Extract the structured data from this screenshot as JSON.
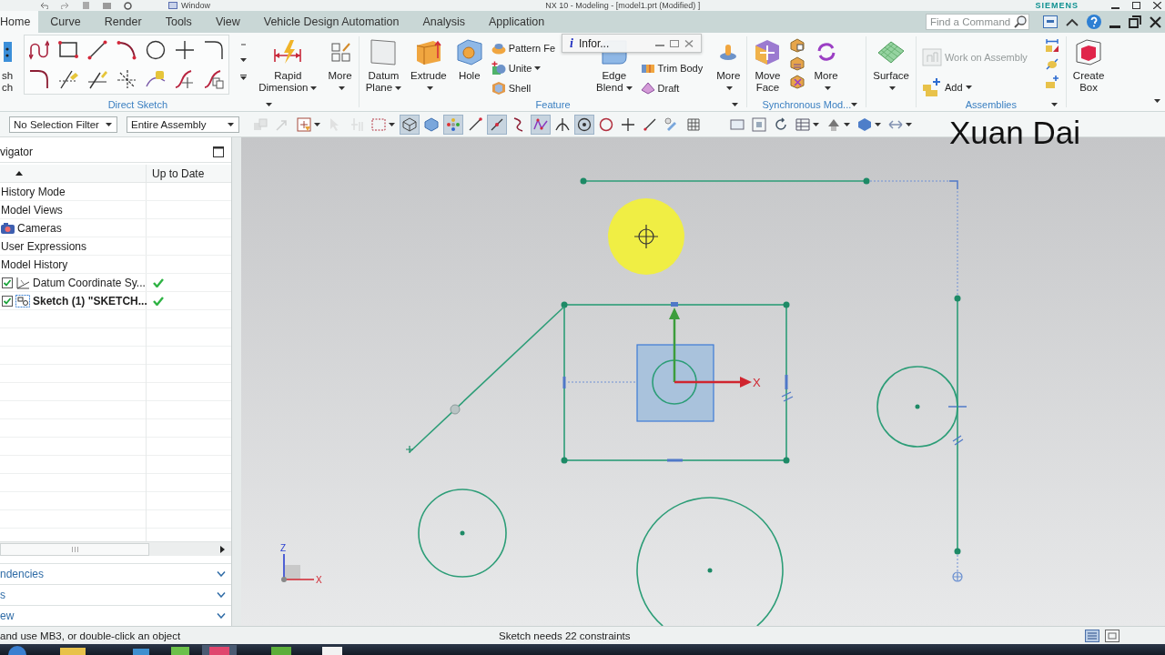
{
  "title_bar": {
    "menu": "Window",
    "title": "NX 10 - Modeling - [model1.prt (Modified) ]",
    "brand": "SIEMENS"
  },
  "tabs": [
    {
      "label": "Home",
      "selected": true
    },
    {
      "label": "Curve",
      "selected": false
    },
    {
      "label": "Render",
      "selected": false
    },
    {
      "label": "Tools",
      "selected": false
    },
    {
      "label": "View",
      "selected": false
    },
    {
      "label": "Vehicle Design Automation",
      "selected": false
    },
    {
      "label": "Analysis",
      "selected": false
    },
    {
      "label": "Application",
      "selected": false
    }
  ],
  "command_search": {
    "placeholder": "Find a Command"
  },
  "ribbon": {
    "groups": [
      {
        "label": "Direct Sketch",
        "menu": true,
        "columns": [
          {
            "kind": "large",
            "lines": [
              "sh",
              "ch"
            ],
            "dropdown": false
          },
          {
            "kind": "palette"
          },
          {
            "kind": "scroller"
          },
          {
            "kind": "large",
            "lines": [
              "Rapid",
              "Dimension"
            ],
            "dropdown": true
          },
          {
            "kind": "large",
            "lines": [
              "More"
            ],
            "dropdown": true
          }
        ]
      },
      {
        "label": "Feature",
        "menu": true,
        "columns": [
          {
            "kind": "large",
            "lines": [
              "Datum",
              "Plane"
            ],
            "dropdown": true
          },
          {
            "kind": "large",
            "lines": [
              "Extrude"
            ],
            "dropdown": true
          },
          {
            "kind": "large",
            "lines": [
              "Hole"
            ],
            "dropdown": false
          },
          {
            "kind": "stack",
            "items": [
              {
                "label": "Pattern Fe",
                "dropdown": false,
                "disabled": false
              },
              {
                "label": "Unite",
                "dropdown": true,
                "disabled": false
              },
              {
                "label": "Shell",
                "dropdown": false,
                "disabled": false
              }
            ]
          },
          {
            "kind": "large",
            "lines": [
              "Edge",
              "Blend"
            ],
            "dropdown": true
          },
          {
            "kind": "stack",
            "items": [
              {
                "label": "Trim Body",
                "dropdown": false,
                "disabled": false
              },
              {
                "label": "Draft",
                "dropdown": false,
                "disabled": false
              }
            ]
          },
          {
            "kind": "large",
            "lines": [
              "More"
            ],
            "dropdown": true
          }
        ]
      },
      {
        "label": "Synchronous Mod...",
        "menu": true,
        "columns": [
          {
            "kind": "large",
            "lines": [
              "Move",
              "Face"
            ],
            "dropdown": false
          },
          {
            "kind": "icons"
          },
          {
            "kind": "large",
            "lines": [
              "More"
            ],
            "dropdown": true
          }
        ]
      },
      {
        "columns": [
          {
            "kind": "large",
            "lines": [
              "Surface"
            ],
            "dropdown": true
          }
        ]
      },
      {
        "label": "Assemblies",
        "menu": true,
        "columns": [
          {
            "kind": "stack",
            "items": [
              {
                "label": "Work on Assembly",
                "dropdown": false,
                "disabled": true
              },
              {
                "label": "Add",
                "dropdown": true,
                "disabled": false
              }
            ]
          },
          {
            "kind": "icons"
          }
        ]
      },
      {
        "columns": [
          {
            "kind": "large",
            "lines": [
              "Create",
              "Box"
            ],
            "dropdown": false
          }
        ]
      }
    ]
  },
  "info_window": {
    "glyph": "i",
    "title": "Infor..."
  },
  "selection_bar": {
    "filters": [
      {
        "value": "No Selection Filter"
      },
      {
        "value": "Entire Assembly"
      }
    ],
    "tool_groups": [
      {
        "tools": [
          {
            "on": false,
            "disabled": true,
            "dropdown": false
          },
          {
            "on": false,
            "disabled": true,
            "dropdown": false
          },
          {
            "on": false,
            "disabled": false,
            "dropdown": true
          },
          {
            "on": false,
            "disabled": true,
            "dropdown": false
          },
          {
            "on": false,
            "disabled": true,
            "dropdown": false
          },
          {
            "on": false,
            "disabled": false,
            "dropdown": true
          },
          {
            "on": true,
            "disabled": false,
            "dropdown": false
          },
          {
            "on": false,
            "disabled": false,
            "dropdown": false
          },
          {
            "on": true,
            "disabled": false,
            "dropdown": false
          },
          {
            "on": false,
            "disabled": false,
            "dropdown": false
          },
          {
            "on": true,
            "disabled": false,
            "dropdown": false
          },
          {
            "on": false,
            "disabled": false,
            "dropdown": false
          },
          {
            "on": true,
            "disabled": false,
            "dropdown": false
          },
          {
            "on": false,
            "disabled": false,
            "dropdown": false
          },
          {
            "on": true,
            "disabled": false,
            "dropdown": false
          },
          {
            "on": false,
            "disabled": false,
            "dropdown": false
          },
          {
            "on": false,
            "disabled": false,
            "dropdown": false
          },
          {
            "on": false,
            "disabled": false,
            "dropdown": false
          },
          {
            "on": false,
            "disabled": false,
            "dropdown": false
          },
          {
            "on": false,
            "disabled": false,
            "dropdown": false
          }
        ]
      },
      {
        "tools": [
          {
            "on": false,
            "disabled": false,
            "dropdown": false
          },
          {
            "on": false,
            "disabled": false,
            "dropdown": false
          },
          {
            "on": false,
            "disabled": false,
            "dropdown": false
          },
          {
            "on": false,
            "disabled": false,
            "dropdown": true
          },
          {
            "on": false,
            "disabled": false,
            "dropdown": true
          },
          {
            "on": false,
            "disabled": false,
            "dropdown": true
          },
          {
            "on": false,
            "disabled": false,
            "dropdown": true
          }
        ]
      }
    ]
  },
  "overlay_text": "Xuan Dai",
  "navigator": {
    "title": "vigator",
    "status_column": "Up to Date",
    "rows": [
      {
        "label": "History Mode",
        "kind": "node"
      },
      {
        "label": "Model Views",
        "kind": "node"
      },
      {
        "label": "Cameras",
        "kind": "camera"
      },
      {
        "label": "User Expressions",
        "kind": "node"
      },
      {
        "label": "Model History",
        "kind": "node",
        "children": [
          {
            "label": "Datum Coordinate Sy...",
            "kind": "datum",
            "checked": true,
            "up_to_date": true,
            "active": false
          },
          {
            "label": "Sketch (1) \"SKETCH...",
            "kind": "sketch",
            "checked": true,
            "up_to_date": true,
            "active": true
          }
        ]
      }
    ],
    "sections": [
      {
        "label": "ndencies",
        "expanded": false
      },
      {
        "label": "s",
        "expanded": false
      },
      {
        "label": "ew",
        "expanded": false
      }
    ]
  },
  "canvas": {
    "axis_label": "X",
    "triad_labels": [
      "Z",
      "X"
    ]
  },
  "status_bar": {
    "prompt": "and use MB3, or double-click an object",
    "message": "Sketch needs 22 constraints"
  }
}
